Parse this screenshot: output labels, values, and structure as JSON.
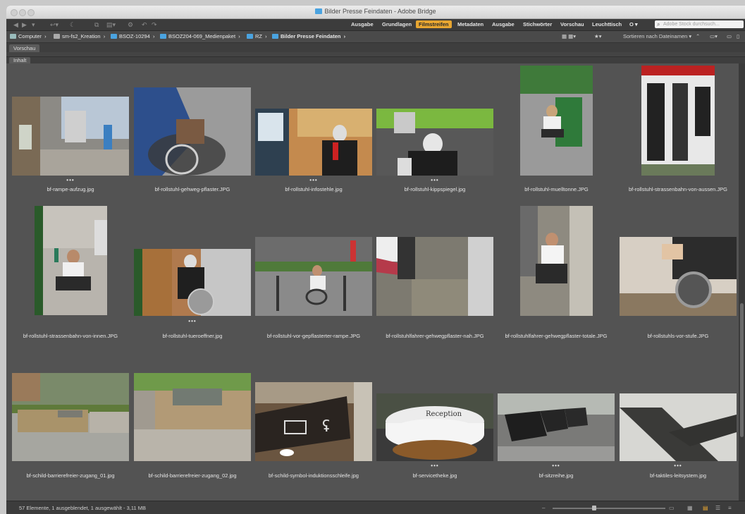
{
  "window": {
    "title": "Bilder Presse Feindaten - Adobe Bridge"
  },
  "workspaces": [
    {
      "label": "Ausgabe",
      "active": false
    },
    {
      "label": "Grundlagen",
      "active": false
    },
    {
      "label": "Filmstreifen",
      "active": true
    },
    {
      "label": "Metadaten",
      "active": false
    },
    {
      "label": "Ausgabe",
      "active": false
    },
    {
      "label": "Stichwörter",
      "active": false
    },
    {
      "label": "Vorschau",
      "active": false
    },
    {
      "label": "Leuchttisch",
      "active": false
    },
    {
      "label": "O ▾",
      "active": false
    }
  ],
  "search": {
    "placeholder": "Adobe Stock durchsuch..."
  },
  "breadcrumb": [
    "Computer",
    "sm-fs2_Kreation",
    "BSOZ-10294",
    "BSOZ204-069_Medienpaket",
    "RZ",
    "Bilder Presse Feindaten"
  ],
  "sort_label": "Sortieren nach Dateinamen ▾",
  "panels": {
    "preview_tab": "Vorschau",
    "content_tab": "Inhalt"
  },
  "files": [
    {
      "name": "bf-rampe-aufzug.jpg",
      "stars": "•••"
    },
    {
      "name": "bf-rollstuhl-gehweg-pflaster.JPG",
      "stars": ""
    },
    {
      "name": "bf-rollstuhl-infostehle.jpg",
      "stars": "•••"
    },
    {
      "name": "bf-rollstuhl-kippspiegel.jpg",
      "stars": "•••"
    },
    {
      "name": "bf-rollstuhl-muelltonne.JPG",
      "stars": ""
    },
    {
      "name": "bf-rollstuhl-strassenbahn-von-aussen.JPG",
      "stars": ""
    },
    {
      "name": "bf-rollstuhl-strassenbahn-von-innen.JPG",
      "stars": ""
    },
    {
      "name": "bf-rollstuhl-tueroeffner.jpg",
      "stars": "•••"
    },
    {
      "name": "bf-rollstuhl-vor-gepflasterter-rampe.JPG",
      "stars": ""
    },
    {
      "name": "bf-rollstuhlfahrer-gehwegpflaster-nah.JPG",
      "stars": ""
    },
    {
      "name": "bf-rollstuhlfahrer-gehwegpflaster-totale.JPG",
      "stars": ""
    },
    {
      "name": "bf-rollstuhls-vor-stufe.JPG",
      "stars": ""
    },
    {
      "name": "bf-schild-barrierefreier-zugang_01.jpg",
      "stars": ""
    },
    {
      "name": "bf-schild-barrierefreier-zugang_02.jpg",
      "stars": ""
    },
    {
      "name": "bf-schild-symbol-induktionsschleife.jpg",
      "stars": ""
    },
    {
      "name": "bf-servicetheke.jpg",
      "stars": "•••"
    },
    {
      "name": "bf-sitzreihe.jpg",
      "stars": "•••"
    },
    {
      "name": "bf-taktiles-leitsystem.jpg",
      "stars": "•••"
    }
  ],
  "status": {
    "text": "57 Elemente, 1 ausgeblendet, 1 ausgewählt - 3,11 MB"
  }
}
